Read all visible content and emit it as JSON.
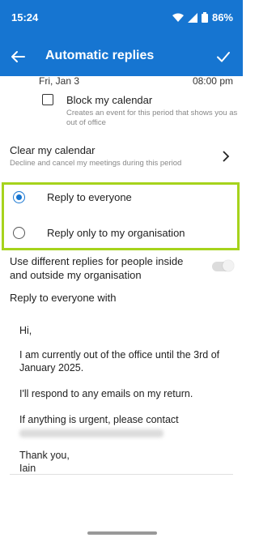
{
  "status": {
    "time": "15:24",
    "battery": "86%"
  },
  "appbar": {
    "title": "Automatic replies"
  },
  "schedule": {
    "date": "Fri, Jan 3",
    "time": "08:00 pm"
  },
  "block_calendar": {
    "label": "Block my calendar",
    "description": "Creates an event for this period that shows you as out of office",
    "checked": false
  },
  "clear_calendar": {
    "label": "Clear my calendar",
    "description": "Decline and cancel my meetings during this period"
  },
  "reply_options": [
    {
      "label": "Reply to everyone",
      "selected": true
    },
    {
      "label": "Reply only to my organisation",
      "selected": false
    }
  ],
  "different_replies": {
    "label": "Use different replies for people inside and outside my organisation",
    "enabled": false
  },
  "reply_with_label": "Reply to everyone with",
  "message": {
    "greeting": "Hi,",
    "line1": "I am currently out of the office until the 3rd of January 2025.",
    "line2": "I'll respond to any emails on my return.",
    "line3": "If anything is urgent, please contact",
    "signoff": "Thank you,",
    "name": "Iain"
  },
  "colors": {
    "primary": "#1675d1",
    "highlight": "#a6d31c"
  }
}
